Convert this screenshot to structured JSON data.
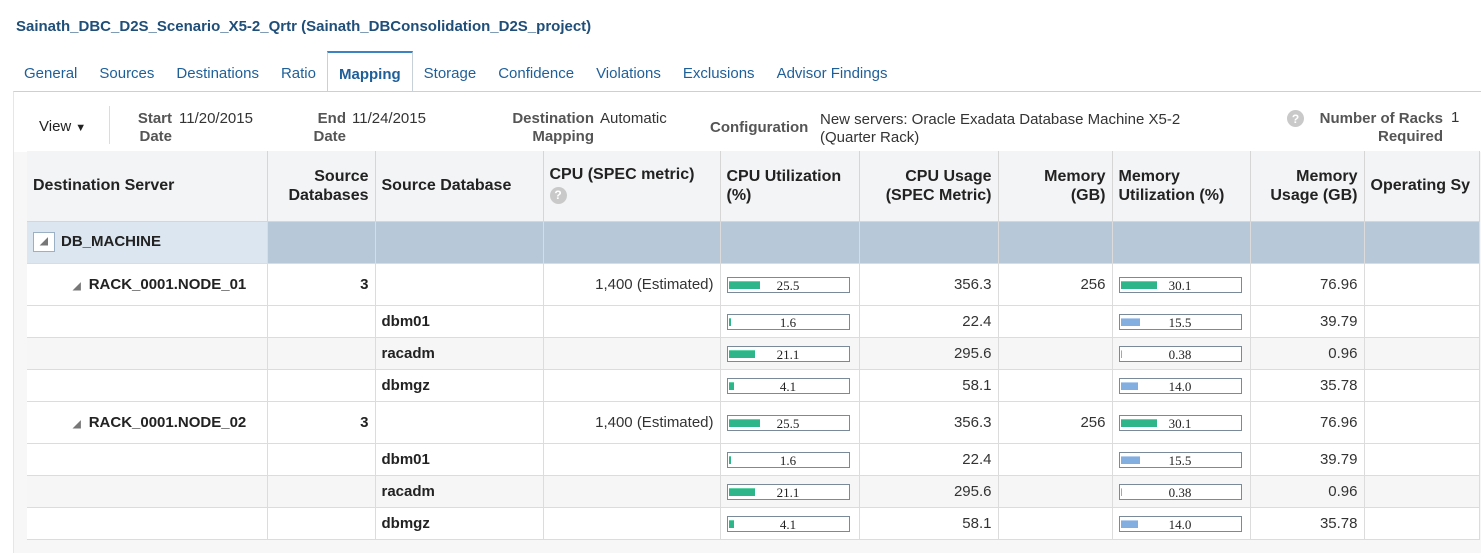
{
  "page_title": "Sainath_DBC_D2S_Scenario_X5-2_Qrtr (Sainath_DBConsolidation_D2S_project)",
  "tabs": [
    {
      "label": "General",
      "active": false
    },
    {
      "label": "Sources",
      "active": false
    },
    {
      "label": "Destinations",
      "active": false
    },
    {
      "label": "Ratio",
      "active": false
    },
    {
      "label": "Mapping",
      "active": true
    },
    {
      "label": "Storage",
      "active": false
    },
    {
      "label": "Confidence",
      "active": false
    },
    {
      "label": "Violations",
      "active": false
    },
    {
      "label": "Exclusions",
      "active": false
    },
    {
      "label": "Advisor Findings",
      "active": false
    }
  ],
  "toolbar": {
    "view_label": "View",
    "start_date_label_1": "Start",
    "start_date_label_2": "Date",
    "start_date_value": "11/20/2015",
    "end_date_label_1": "End",
    "end_date_label_2": "Date",
    "end_date_value": "11/24/2015",
    "dest_mapping_label_1": "Destination",
    "dest_mapping_label_2": "Mapping",
    "dest_mapping_value": "Automatic",
    "configuration_label": "Configuration",
    "configuration_value_1": "New servers: Oracle Exadata Database Machine X5-2",
    "configuration_value_2": "(Quarter Rack)",
    "racks_label_1": "Number of Racks",
    "racks_label_2": "Required",
    "racks_value": "1"
  },
  "columns": {
    "destination_server": "Destination Server",
    "source_databases_1": "Source",
    "source_databases_2": "Databases",
    "source_database": "Source Database",
    "cpu_spec": "CPU (SPEC metric)",
    "cpu_util_1": "CPU Utilization",
    "cpu_util_2": "(%)",
    "cpu_usage_1": "CPU Usage",
    "cpu_usage_2": "(SPEC Metric)",
    "memory_1": "Memory",
    "memory_2": "(GB)",
    "mem_util_1": "Memory",
    "mem_util_2": "Utilization (%)",
    "mem_usage_1": "Memory",
    "mem_usage_2": "Usage (GB)",
    "os": "Operating Sy"
  },
  "group": {
    "name": "DB_MACHINE"
  },
  "nodes": [
    {
      "name": "RACK_0001.NODE_01",
      "source_databases": "3",
      "cpu_spec": "1,400 (Estimated)",
      "cpu_util": "25.5",
      "cpu_util_pct": 25.5,
      "cpu_usage": "356.3",
      "memory": "256",
      "mem_util": "30.1",
      "mem_util_pct": 30.1,
      "mem_usage": "76.96",
      "databases": [
        {
          "name": "dbm01",
          "cpu_util": "1.6",
          "cpu_util_pct": 1.6,
          "cpu_usage": "22.4",
          "mem_util": "15.5",
          "mem_util_pct": 15.5,
          "mem_usage": "39.79"
        },
        {
          "name": "racadm",
          "cpu_util": "21.1",
          "cpu_util_pct": 21.1,
          "cpu_usage": "295.6",
          "mem_util": "0.38",
          "mem_util_pct": 0.38,
          "mem_usage": "0.96"
        },
        {
          "name": "dbmgz",
          "cpu_util": "4.1",
          "cpu_util_pct": 4.1,
          "cpu_usage": "58.1",
          "mem_util": "14.0",
          "mem_util_pct": 14.0,
          "mem_usage": "35.78"
        }
      ]
    },
    {
      "name": "RACK_0001.NODE_02",
      "source_databases": "3",
      "cpu_spec": "1,400 (Estimated)",
      "cpu_util": "25.5",
      "cpu_util_pct": 25.5,
      "cpu_usage": "356.3",
      "memory": "256",
      "mem_util": "30.1",
      "mem_util_pct": 30.1,
      "mem_usage": "76.96",
      "databases": [
        {
          "name": "dbm01",
          "cpu_util": "1.6",
          "cpu_util_pct": 1.6,
          "cpu_usage": "22.4",
          "mem_util": "15.5",
          "mem_util_pct": 15.5,
          "mem_usage": "39.79"
        },
        {
          "name": "racadm",
          "cpu_util": "21.1",
          "cpu_util_pct": 21.1,
          "cpu_usage": "295.6",
          "mem_util": "0.38",
          "mem_util_pct": 0.38,
          "mem_usage": "0.96"
        },
        {
          "name": "dbmgz",
          "cpu_util": "4.1",
          "cpu_util_pct": 4.1,
          "cpu_usage": "58.1",
          "mem_util": "14.0",
          "mem_util_pct": 14.0,
          "mem_usage": "35.78"
        }
      ]
    }
  ],
  "colors": {
    "cpu_bar": "#2eb58a",
    "mem_bar_child": "#82aee0",
    "group_row": "#b7c9d8",
    "tab_accent": "#3a84c4"
  }
}
